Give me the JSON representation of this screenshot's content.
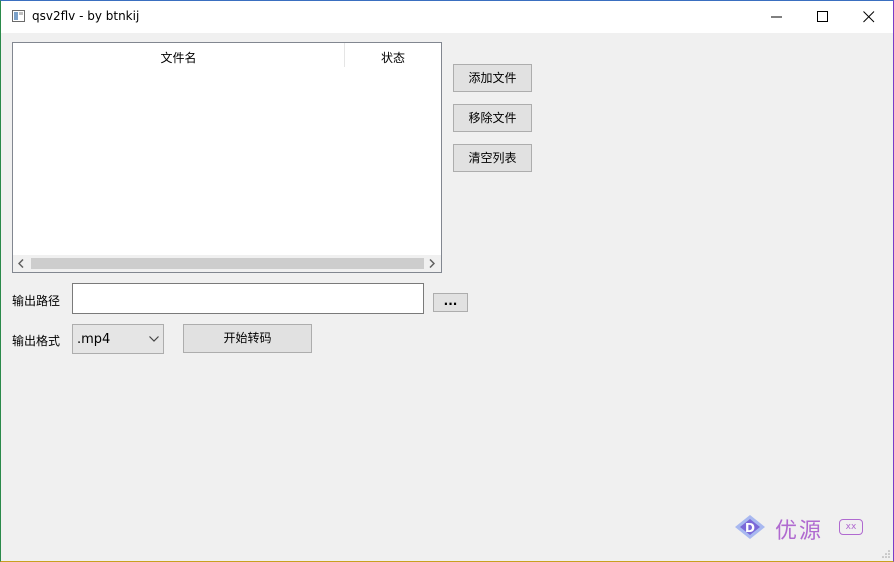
{
  "window": {
    "title": "qsv2flv - by btnkij",
    "icons": {
      "app": "app-icon",
      "minimize": "minimize-icon",
      "maximize": "maximize-icon",
      "close": "close-icon"
    }
  },
  "file_list": {
    "columns": [
      "文件名",
      "状态"
    ],
    "rows": []
  },
  "buttons": {
    "add": "添加文件",
    "remove": "移除文件",
    "clear": "清空列表",
    "browse": "...",
    "start": "开始转码"
  },
  "output": {
    "path_label": "输出路径",
    "path_value": "",
    "format_label": "输出格式",
    "format_value": ".mp4"
  },
  "watermark": {
    "text": "优源",
    "badge": "xx"
  },
  "colors": {
    "window_bg": "#f0f0f0",
    "button_bg": "#e1e1e1",
    "watermark": "#b06ad0"
  }
}
